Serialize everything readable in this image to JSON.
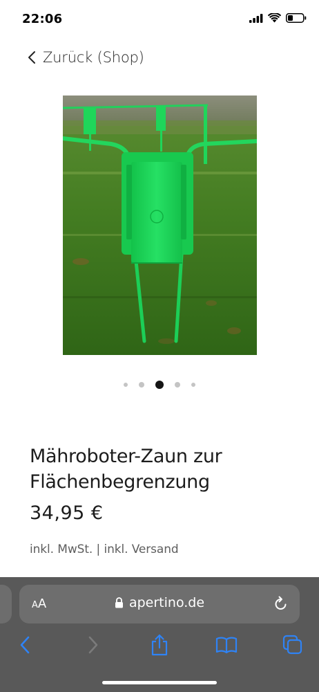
{
  "status_bar": {
    "time": "22:06",
    "icons": [
      "cellular-signal-icon",
      "wifi-icon",
      "battery-icon"
    ]
  },
  "nav": {
    "back_label": "Zurück (Shop)",
    "back_icon": "chevron-left-icon"
  },
  "product": {
    "image_icon": "product-photo-garden-fence",
    "carousel": {
      "total": 5,
      "active_index": 2
    },
    "title": "Mähroboter-Zaun zur Flächenbegrenzung",
    "price": "34,95 €",
    "tax_note": "inkl. MwSt. | inkl. Versand"
  },
  "browser": {
    "text_size_label_small": "A",
    "text_size_label_large": "A",
    "url": "apertino.de",
    "toolbar_icons": [
      "back-icon",
      "forward-icon",
      "share-icon",
      "bookmarks-icon",
      "tabs-icon"
    ]
  },
  "colors": {
    "accent_blue": "#2f83f5",
    "browser_bar": "#595959",
    "fence_green": "#1fd65a",
    "grass": "#3f7a22"
  }
}
